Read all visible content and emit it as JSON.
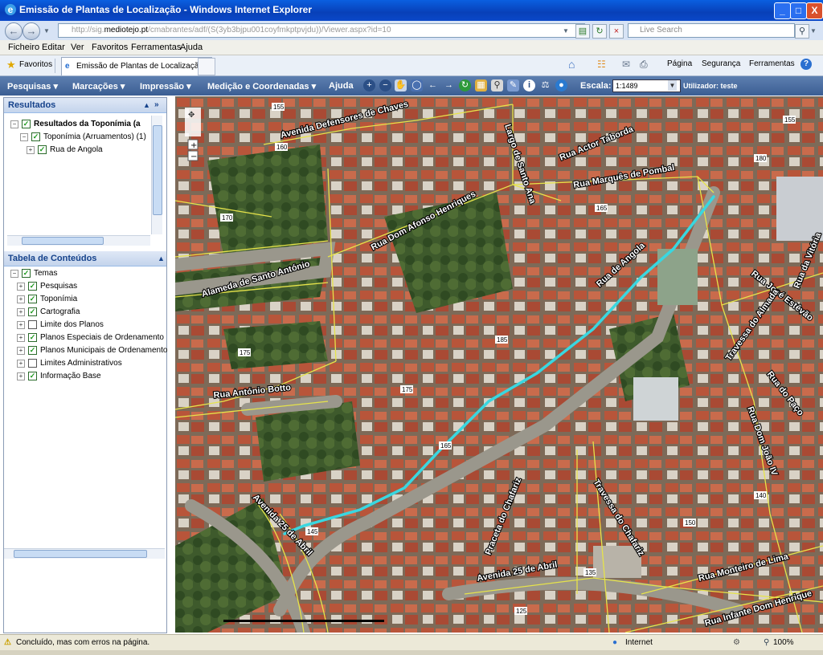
{
  "window": {
    "title": "Emissão de Plantas de Localização - Windows Internet Explorer",
    "minimize": "_",
    "maximize": "□",
    "close": "X"
  },
  "address": {
    "url_prefix": "http://sig.",
    "url_domain": "mediotejo.pt",
    "url_rest": "/cmabrantes/adf/(S(3yb3bjpu001coyfmkptpvjdu))/Viewer.aspx?id=10",
    "search_placeholder": "Live Search"
  },
  "menu": [
    "Ficheiro",
    "Editar",
    "Ver",
    "Favoritos",
    "Ferramentas",
    "Ajuda"
  ],
  "favorites": {
    "label": "Favoritos",
    "tab_title": "Emissão de Plantas de Localização",
    "commands": [
      "Página",
      "Segurança",
      "Ferramentas"
    ]
  },
  "app_toolbar": {
    "menus": [
      "Pesquisas ▾",
      "Marcações ▾",
      "Impressão ▾",
      "Medição e Coordenadas ▾",
      "Ajuda"
    ],
    "scale_label": "Escala:",
    "scale_value": "1:1489",
    "user_label": "Utilizador: teste"
  },
  "results_panel": {
    "title": "Resultados",
    "tree": [
      {
        "label": "Resultados da Toponímia (a",
        "bold": true,
        "checked": true
      },
      {
        "label": "Toponímia (Arruamentos) (1)",
        "checked": true
      },
      {
        "label": "Rua de Angola",
        "checked": true
      }
    ]
  },
  "toc_panel": {
    "title": "Tabela de Conteúdos",
    "root": "Temas",
    "items": [
      {
        "label": "Pesquisas",
        "checked": true
      },
      {
        "label": "Toponímia",
        "checked": true
      },
      {
        "label": "Cartografia",
        "checked": true
      },
      {
        "label": "Limite dos Planos",
        "checked": false
      },
      {
        "label": "Planos Especiais de Ordenamento",
        "checked": true
      },
      {
        "label": "Planos Municipais de Ordenamento",
        "checked": true
      },
      {
        "label": "Limites Administrativos",
        "checked": false
      },
      {
        "label": "Informação Base",
        "checked": true
      }
    ]
  },
  "map": {
    "highlight_color": "#39d7e0",
    "street_labels": [
      "Avenida Defensores de Chaves",
      "Largo de Santo Ana",
      "Rua Actor Taborda",
      "Rua Marquês de Pombal",
      "Rua Dom Afonso Henriques",
      "Alameda de Santo António",
      "Rua de Angola",
      "Rua José Estêvão",
      "Rua da Vitória",
      "Travessa do Almada",
      "Rua do Paço",
      "Rua António Botto",
      "Rua Dom João IV",
      "Avenida 25 de Abril",
      "Praceta do Chafariz",
      "Travessa do Chafariz",
      "Rua Monteiro de Lima",
      "Rua Infante Dom Henrique"
    ],
    "elevation_labels": [
      "155",
      "160",
      "175",
      "170",
      "165",
      "180",
      "185",
      "175",
      "155",
      "165",
      "150",
      "145",
      "140",
      "135",
      "125"
    ]
  },
  "status": {
    "message": "Concluído, mas com erros na página.",
    "zone": "Internet",
    "zoom": "100%"
  }
}
